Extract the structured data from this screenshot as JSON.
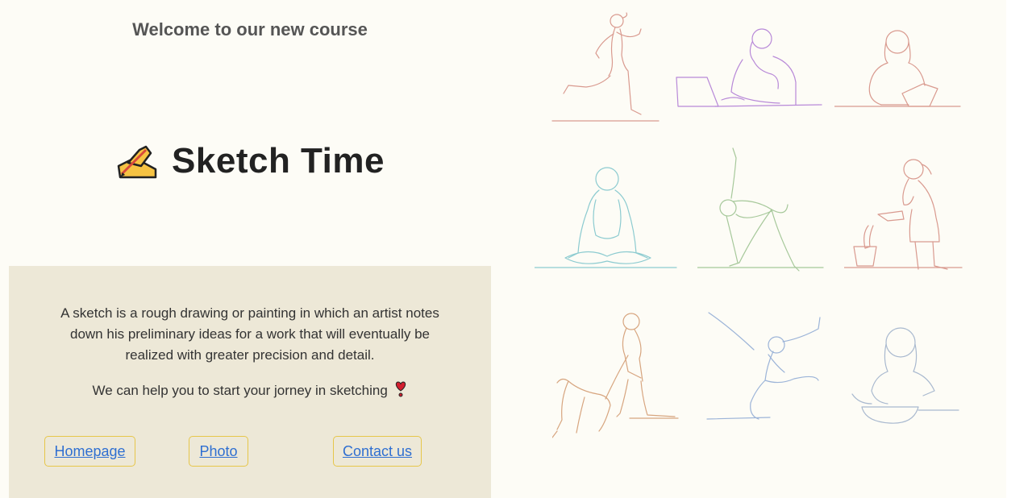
{
  "header": {
    "welcome": "Welcome to our new course"
  },
  "hero": {
    "title": "Sketch Time",
    "icon": "writing-hand-icon"
  },
  "info": {
    "description": "A sketch is a rough drawing or painting in which an artist notes down his preliminary ideas for a work that will eventually be realized with greater precision and detail.",
    "cta": "We can help you to start your jorney in sketching",
    "cta_icon": "heart-exclamation-icon"
  },
  "nav": {
    "homepage_label": "Homepage",
    "photo_label": "Photo",
    "contact_label": "Contact us"
  },
  "colors": {
    "page_bg": "#fdfcf6",
    "box_bg": "#ede8d7",
    "button_border": "#e6c64a",
    "link": "#2f6fd1"
  },
  "gallery": [
    {
      "icon": "runner-sketch-icon"
    },
    {
      "icon": "laptop-thinker-sketch-icon"
    },
    {
      "icon": "reader-sketch-icon"
    },
    {
      "icon": "meditation-sketch-icon"
    },
    {
      "icon": "yoga-triangle-sketch-icon"
    },
    {
      "icon": "watering-plant-sketch-icon"
    },
    {
      "icon": "dog-walker-sketch-icon"
    },
    {
      "icon": "dancer-leap-sketch-icon"
    },
    {
      "icon": "cook-sketch-icon"
    }
  ]
}
